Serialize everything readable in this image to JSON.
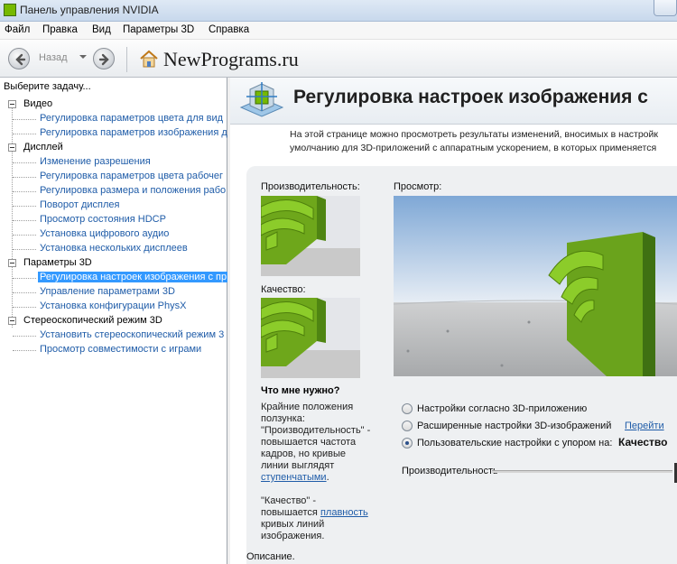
{
  "window": {
    "title": "Панель управления NVIDIA"
  },
  "menu": {
    "items": [
      "Файл",
      "Правка",
      "Вид",
      "Параметры 3D",
      "Справка"
    ]
  },
  "toolbar": {
    "back_label": "Назад",
    "brand": "NewPrograms.ru"
  },
  "sidebar": {
    "task_label": "Выберите задачу...",
    "categories": [
      {
        "label": "Видео",
        "items": [
          "Регулировка параметров цвета для вид",
          "Регулировка параметров изображения д"
        ]
      },
      {
        "label": "Дисплей",
        "items": [
          "Изменение разрешения",
          "Регулировка параметров цвета рабочег",
          "Регулировка размера и положения рабо",
          "Поворот дисплея",
          "Просмотр состояния HDCP",
          "Установка цифрового аудио",
          "Установка нескольких дисплеев"
        ]
      },
      {
        "label": "Параметры 3D",
        "items": [
          "Регулировка настроек изображения с пр",
          "Управление параметрами 3D",
          "Установка конфигурации PhysX"
        ]
      },
      {
        "label": "Стереоскопический режим 3D",
        "items": [
          "Установить стереоскопический режим 3",
          "Просмотр совместимости с играми"
        ]
      }
    ],
    "selected_item": "Регулировка настроек изображения с пр"
  },
  "main": {
    "title": "Регулировка настроек изображения с",
    "intro_line1": "На этой странице можно просмотреть результаты изменений, вносимых в настройк",
    "intro_line2": "умолчанию для 3D-приложений с аппаратным ускорением, в которых применяется",
    "performance_label": "Производительность:",
    "quality_label": "Качество:",
    "preview_label": "Просмотр:",
    "help": {
      "heading": "Что мне нужно?",
      "p1_pre": "Крайние положения ползунка: \"Производительность\" - повышается частота кадров, но кривые линии выглядят ",
      "p1_link": "ступенчатыми",
      "p1_post": ".",
      "p2_pre": "\"Качество\" - повышается ",
      "p2_link": "плавность",
      "p2_post": " кривых линий изображения."
    },
    "options": {
      "opt1": "Настройки согласно 3D-приложению",
      "opt2": "Расширенные настройки 3D-изображений",
      "opt2_link": "Перейти",
      "opt3": "Пользовательские настройки с упором на:",
      "opt3_value": "Качество",
      "selected": "opt3"
    },
    "slider_label": "Производительность",
    "footer_label": "Описание."
  },
  "colors": {
    "nvidia_green": "#76b900",
    "link": "#1f5ca8",
    "selection": "#3399ff"
  }
}
